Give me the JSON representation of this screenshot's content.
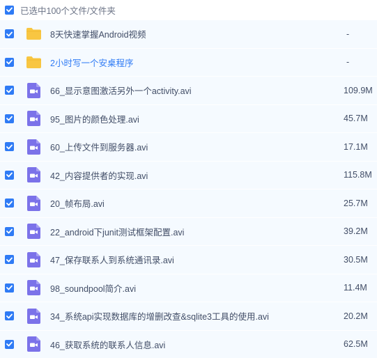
{
  "header": {
    "label": "已选中100个文件/文件夹"
  },
  "colors": {
    "accent": "#2f7bf5",
    "folder": "#f8c642",
    "video": "#7b72e9",
    "row_bg": "#f5faff"
  },
  "items": [
    {
      "type": "folder",
      "name": "8天快速掌握Android视频",
      "size": "-",
      "link": false
    },
    {
      "type": "folder",
      "name": "2小时写一个安桌程序",
      "size": "-",
      "link": true
    },
    {
      "type": "video",
      "name": "66_显示意图激活另外一个activity.avi",
      "size": "109.9M"
    },
    {
      "type": "video",
      "name": "95_图片的颜色处理.avi",
      "size": "45.7M"
    },
    {
      "type": "video",
      "name": "60_上传文件到服务器.avi",
      "size": "17.1M"
    },
    {
      "type": "video",
      "name": "42_内容提供者的实现.avi",
      "size": "115.8M"
    },
    {
      "type": "video",
      "name": "20_帧布局.avi",
      "size": "25.7M"
    },
    {
      "type": "video",
      "name": "22_android下junit测试框架配置.avi",
      "size": "39.2M"
    },
    {
      "type": "video",
      "name": "47_保存联系人到系统通讯录.avi",
      "size": "30.5M"
    },
    {
      "type": "video",
      "name": "98_soundpool简介.avi",
      "size": "11.4M"
    },
    {
      "type": "video",
      "name": "34_系统api实现数据库的增删改查&sqlite3工具的使用.avi",
      "size": "20.2M"
    },
    {
      "type": "video",
      "name": "46_获取系统的联系人信息.avi",
      "size": "62.5M"
    }
  ]
}
